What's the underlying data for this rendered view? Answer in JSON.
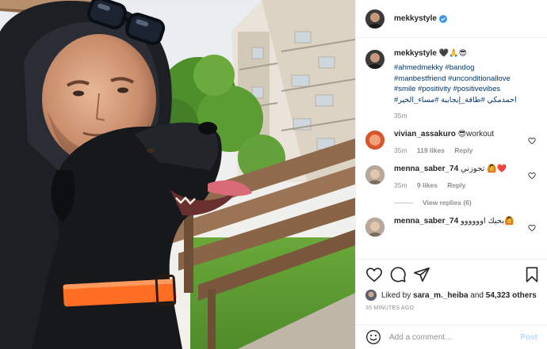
{
  "post": {
    "username": "mekkystyle",
    "caption_emojis": "🖤🙏😎",
    "hashtags_lines": [
      "#ahmedmekky #bandog",
      "#manbestfriend #unconditionallove",
      "#smile #positivity #positivevibes",
      "احمدمكي #طاقة_إيجابية #مساء_الخير#"
    ],
    "caption_time": "35m"
  },
  "comments": [
    {
      "username": "vivian_assakuro",
      "text": "😎workout",
      "time": "35m",
      "likes": "119 likes",
      "reply": "Reply"
    },
    {
      "username": "menna_saber_74",
      "text": "تجوزني 🙆❤️",
      "time": "35m",
      "likes": "9 likes",
      "reply": "Reply",
      "view_replies": "View replies (6)"
    },
    {
      "username": "menna_saber_74",
      "text": "بحبك اوووووو🙆"
    }
  ],
  "actions": {
    "liked_by_prefix": "Liked by ",
    "liked_by_user": "sara_m._heiba",
    "liked_by_mid": " and ",
    "liked_by_count": "54,323 others",
    "time_ago": "35 MINUTES AGO"
  },
  "add_comment": {
    "placeholder": "Add a comment…",
    "post_label": "Post"
  },
  "colors": {
    "link": "#00376b",
    "muted": "#8e8e8e",
    "verified": "#3897f0",
    "post_disabled": "#b3dbff",
    "like_heart": "#ed4956"
  },
  "icons": [
    "verified-badge-icon",
    "heart-icon",
    "comment-icon",
    "share-icon",
    "bookmark-icon",
    "emoji-icon"
  ]
}
